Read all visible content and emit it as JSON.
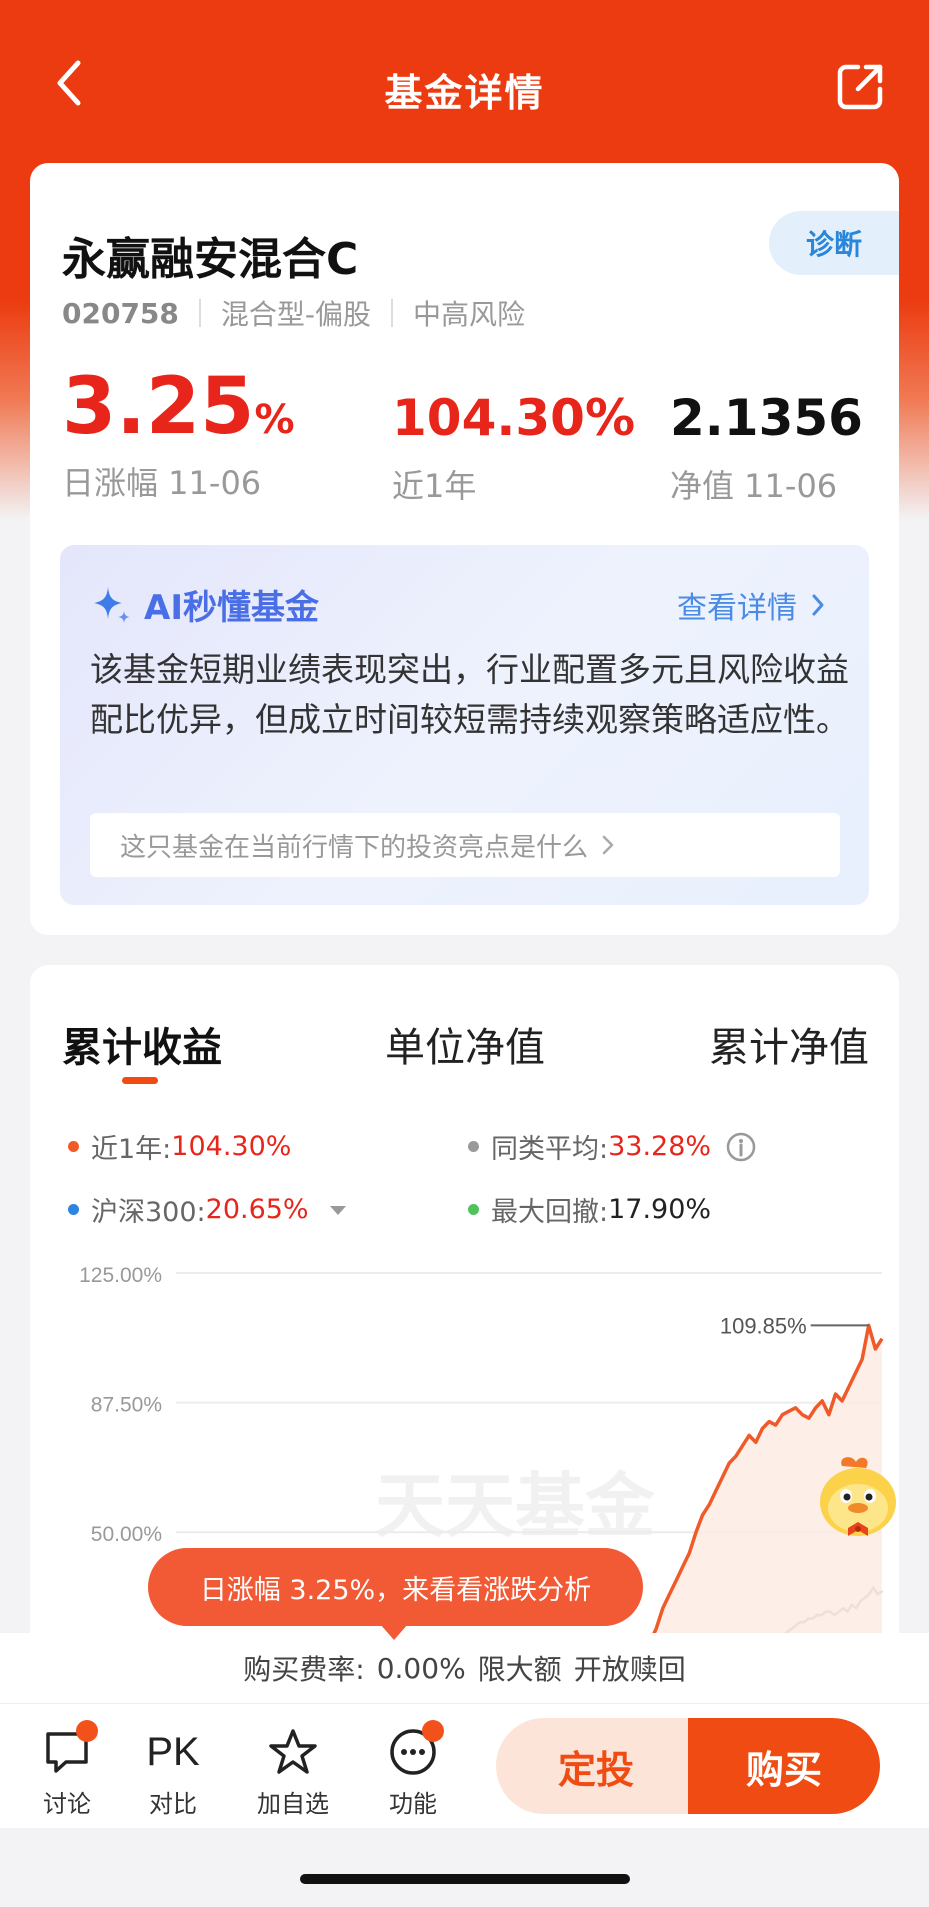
{
  "header": {
    "title": "基金详情"
  },
  "fund": {
    "name": "永赢融安混合C",
    "diagnose_label": "诊断",
    "code": "020758",
    "type": "混合型-偏股",
    "risk": "中高风险",
    "daily_change": "3.25",
    "daily_change_unit": "%",
    "daily_change_label": "日涨幅 11-06",
    "one_year": "104.30%",
    "one_year_label": "近1年",
    "nav": "2.1356",
    "nav_label": "净值 11-06"
  },
  "ai": {
    "title": "AI秒懂基金",
    "more_label": "查看详情",
    "summary": "该基金短期业绩表现突出，行业配置多元且风险收益配比优异，但成立时间较短需持续观察策略适应性。",
    "question": "这只基金在当前行情下的投资亮点是什么"
  },
  "chart_tabs": [
    {
      "label": "累计收益",
      "active": true
    },
    {
      "label": "单位净值",
      "active": false
    },
    {
      "label": "累计净值",
      "active": false
    }
  ],
  "legend": {
    "fund": {
      "label": "近1年:",
      "value": "104.30%",
      "color": "#f05a28"
    },
    "peer": {
      "label": "同类平均:",
      "value": "33.28%",
      "color": "#999999"
    },
    "index": {
      "label": "沪深300:",
      "value": "20.65%",
      "color": "#2a86e0"
    },
    "drawdown": {
      "label": "最大回撤:",
      "value": "17.90%",
      "color": "#4cc45a"
    }
  },
  "chart_data": {
    "type": "line",
    "y_ticks": [
      "125.00%",
      "87.50%",
      "50.00%"
    ],
    "ylim": [
      0,
      125
    ],
    "peak_label": "109.85%",
    "watermark": "天天基金",
    "series": [
      {
        "name": "近1年",
        "color": "#f05a28",
        "values": [
          0,
          1,
          2,
          1,
          3,
          2,
          4,
          3,
          2,
          4,
          5,
          3,
          4,
          6,
          5,
          7,
          8,
          6,
          9,
          12,
          15,
          18,
          22,
          28,
          32,
          36,
          40,
          44,
          50,
          55,
          58,
          62,
          66,
          70,
          72,
          75,
          78,
          76,
          80,
          82,
          81,
          84,
          85,
          86,
          84,
          83,
          86,
          88,
          84,
          90,
          88,
          92,
          96,
          100,
          109.85,
          103,
          106
        ]
      },
      {
        "name": "同类平均",
        "color": "#999999",
        "values": [
          0,
          0,
          1,
          0,
          1,
          1,
          2,
          1,
          1,
          2,
          2,
          1,
          2,
          2,
          2,
          3,
          3,
          2,
          3,
          4,
          5,
          6,
          7,
          8,
          10,
          11,
          12,
          14,
          15,
          16,
          17,
          18,
          19,
          20,
          21,
          22,
          23,
          24,
          24,
          25,
          25,
          26,
          26,
          27,
          27,
          26,
          27,
          28,
          27,
          29,
          28,
          30,
          31,
          32,
          34,
          32,
          33
        ]
      },
      {
        "name": "沪深300",
        "color": "#2a86e0",
        "values": [
          0,
          0,
          0,
          0,
          1,
          0,
          1,
          0,
          0,
          1,
          1,
          0,
          1,
          1,
          1,
          1,
          2,
          1,
          2,
          2,
          3,
          3,
          4,
          5,
          6,
          6,
          7,
          8,
          9,
          10,
          10,
          11,
          11,
          12,
          12,
          13,
          13,
          14,
          14,
          15,
          15,
          15,
          16,
          16,
          17,
          16,
          17,
          17,
          16,
          18,
          17,
          18,
          19,
          19,
          20,
          19,
          20
        ]
      }
    ]
  },
  "tip": {
    "text": "日涨幅 3.25%，来看看涨跌分析"
  },
  "fee_bar": {
    "fee_label": "购买费率:",
    "fee_value": "0.00%",
    "limit": "限大额",
    "status": "开放赎回"
  },
  "bottom_nav": [
    {
      "label": "讨论",
      "icon": "comment-icon"
    },
    {
      "label": "对比",
      "icon": "pk-icon",
      "icon_text": "PK"
    },
    {
      "label": "加自选",
      "icon": "star-icon"
    },
    {
      "label": "功能",
      "icon": "more-icon"
    }
  ],
  "actions": {
    "auto_invest": "定投",
    "buy": "购买"
  }
}
